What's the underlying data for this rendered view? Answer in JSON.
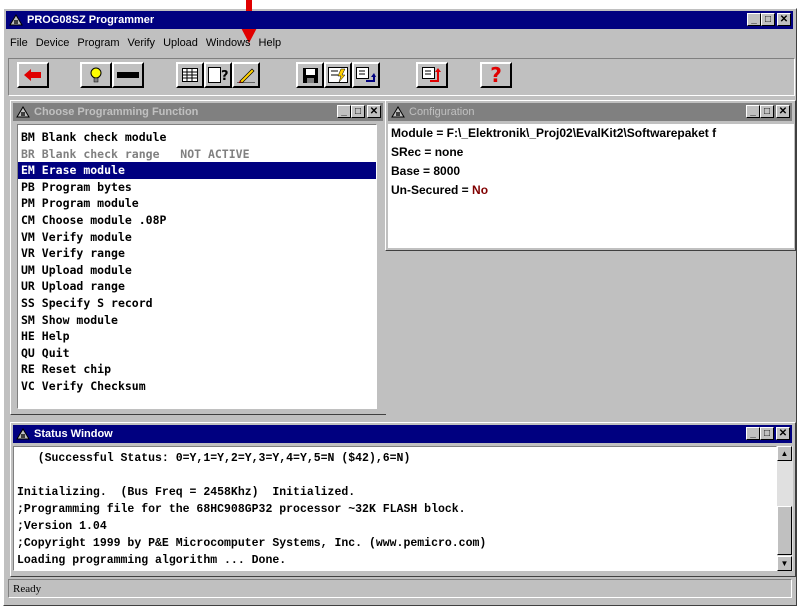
{
  "app": {
    "title": "PROG08SZ Programmer"
  },
  "menu": [
    "File",
    "Device",
    "Program",
    "Verify",
    "Upload",
    "Windows",
    "Help"
  ],
  "toolbar": {
    "icons": [
      "back-arrow-icon",
      "bulb-icon",
      "chip-icon",
      "grid-icon",
      "help-doc-icon",
      "pencil-erase-icon",
      "save-icon",
      "program-icon",
      "verify-icon",
      "upload-icon",
      "help-question-icon"
    ],
    "help_glyph": "?"
  },
  "functions_window": {
    "title": "Choose Programming Function",
    "items": [
      {
        "code": "BM",
        "label": "Blank check module",
        "state": "normal"
      },
      {
        "code": "BR",
        "label": "Blank check range   NOT ACTIVE",
        "state": "disabled"
      },
      {
        "code": "EM",
        "label": "Erase module",
        "state": "selected"
      },
      {
        "code": "PB",
        "label": "Program bytes",
        "state": "normal"
      },
      {
        "code": "PM",
        "label": "Program module",
        "state": "normal"
      },
      {
        "code": "CM",
        "label": "Choose module .08P",
        "state": "normal"
      },
      {
        "code": "VM",
        "label": "Verify module",
        "state": "normal"
      },
      {
        "code": "VR",
        "label": "Verify range",
        "state": "normal"
      },
      {
        "code": "UM",
        "label": "Upload module",
        "state": "normal"
      },
      {
        "code": "UR",
        "label": "Upload range",
        "state": "normal"
      },
      {
        "code": "SS",
        "label": "Specify S record",
        "state": "normal"
      },
      {
        "code": "SM",
        "label": "Show module",
        "state": "normal"
      },
      {
        "code": "HE",
        "label": "Help",
        "state": "normal"
      },
      {
        "code": "QU",
        "label": "Quit",
        "state": "normal"
      },
      {
        "code": "RE",
        "label": "Reset chip",
        "state": "normal"
      },
      {
        "code": "VC",
        "label": "Verify Checksum",
        "state": "normal"
      }
    ]
  },
  "config_window": {
    "title": "Configuration",
    "module": "Module = F:\\_Elektronik\\_Proj02\\EvalKit2\\Softwarepaket f",
    "srec": "SRec = none",
    "base": "Base = 8000",
    "unsecured_label": "Un-Secured = ",
    "unsecured_value": "No"
  },
  "status_window": {
    "title": "Status Window",
    "lines": [
      "   (Successful Status: 0=Y,1=Y,2=Y,3=Y,4=Y,5=N ($42),6=N)",
      "",
      "Initializing.  (Bus Freq = 2458Khz)  Initialized.",
      ";Programming file for the 68HC908GP32 processor ~32K FLASH block.",
      ";Version 1.04",
      ";Copyright 1999 by P&E Microcomputer Systems, Inc. (www.pemicro.com)",
      "Loading programming algorithm ... Done."
    ]
  },
  "statusbar": {
    "text": "Ready"
  },
  "colors": {
    "title_active": "#000080",
    "title_inactive": "#808080",
    "highlight": "#000080",
    "value_red": "#800000",
    "arrow_red": "#e00000"
  }
}
